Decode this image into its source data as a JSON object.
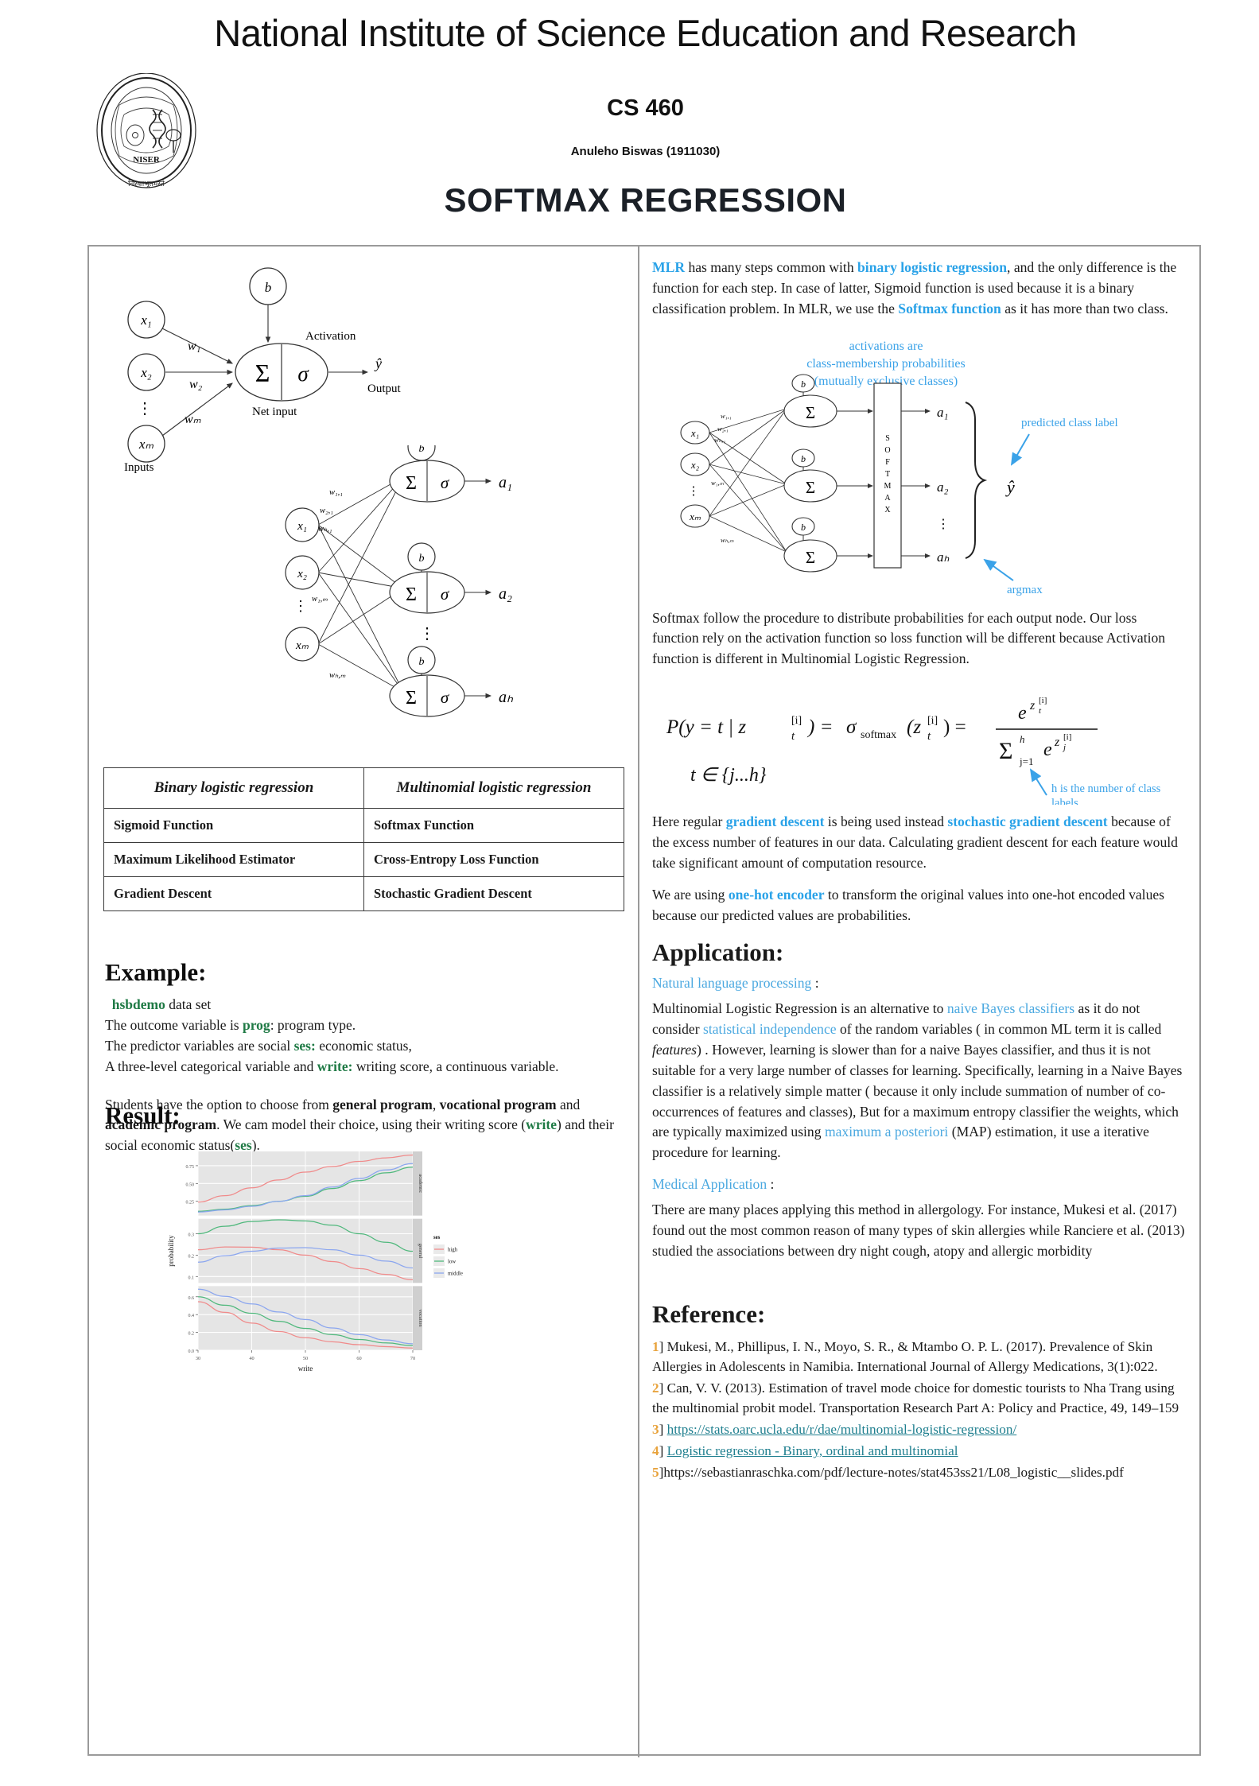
{
  "header": {
    "university": "National Institute of Science Education and Research",
    "course_code": "CS 460",
    "author": "Anuleho Biswas (1911030)",
    "poster_title": "SOFTMAX REGRESSION",
    "logo_name": "NISER",
    "logo_motto": "विश्वाःभूतमस्ते",
    "logo_top_text": "राष्ट्रीय विज्ञान शिक्षा एवं अनुसंधान संस्थान"
  },
  "left": {
    "diagram1": {
      "inputs_label": "Inputs",
      "bias": "b",
      "nodes": [
        "x₁",
        "x₂",
        "xₘ"
      ],
      "weights": [
        "w₁",
        "w₂",
        "wₘ"
      ],
      "net_input_label": "Net input",
      "activation_label": "Activation",
      "sum_symbol": "Σ",
      "sigma_symbol": "σ",
      "output_symbol": "ŷ",
      "output_label": "Output"
    },
    "diagram2": {
      "inputs": [
        "x₁",
        "x₂",
        "xₘ"
      ],
      "weights": [
        "w₁,₁",
        "w₂,₁",
        "wₕ,₁",
        "w₁,ₘ",
        "wₕ,ₘ"
      ],
      "bias": "b",
      "outputs": [
        "a₁",
        "a₂",
        "aₕ"
      ],
      "sum_symbol": "Σ",
      "sigma_symbol": "σ"
    },
    "table": {
      "headers": [
        "Binary logistic regression",
        "Multinomial logistic regression"
      ],
      "rows": [
        [
          "Sigmoid Function",
          "Softmax Function"
        ],
        [
          "Maximum Likelihood Estimator",
          "Cross-Entropy Loss Function"
        ],
        [
          "Gradient Descent",
          "Stochastic Gradient Descent"
        ]
      ]
    },
    "example": {
      "heading": "Example",
      "heading_colon": ":",
      "dataset_name": "hsbdemo",
      "dataset_suffix": " data set",
      "line_outcome_pre": "The outcome variable is  ",
      "line_outcome_var": "prog",
      "line_outcome_post": ":  program type.",
      "line_pred_pre": "The predictor variables are social ",
      "line_pred_var": "ses:",
      "line_pred_post": " economic status,",
      "line_three_pre": "A three-level categorical variable and ",
      "line_three_var": "write:",
      "line_three_post": " writing score,  a continuous variable.",
      "para2_a": "Students have the option to choose from ",
      "para2_b1": "general program",
      "para2_c": ", ",
      "para2_b2": "vocational program",
      "para2_d": " and ",
      "para2_b3": "academic program",
      "para2_e": ". We cam model their choice, using their writing score (",
      "para2_g1": "write",
      "para2_f": ") and their social economic status(",
      "para2_g2": "ses",
      "para2_h": ")."
    },
    "result": {
      "heading": "Result",
      "heading_colon": ":"
    }
  },
  "right": {
    "para1_a": "MLR",
    "para1_b": " has many steps common with ",
    "para1_c": "binary logistic regression",
    "para1_d": ", and the only difference is the function for each step. In case of latter, Sigmoid function is used because it is a binary classification problem. In MLR, we use the ",
    "para1_e": "Softmax function",
    "para1_f": " as it has more than two class.",
    "diagram3": {
      "annotation_top_line1": "activations are",
      "annotation_top_line2": "class-membership probabilities",
      "annotation_top_line3": "(mutually exclusive classes)",
      "softmax_label": "SOFTMAX",
      "predicted_label": "predicted class label",
      "argmax_label": "argmax",
      "yhat": "ŷ",
      "bias": "b",
      "sum_symbol": "Σ",
      "inputs": [
        "x₁",
        "x₂",
        "xₘ"
      ],
      "outputs": [
        "a₁",
        "a₂",
        "aₕ"
      ],
      "weights": [
        "w₁,₁",
        "w₂,₁",
        "wₕ,₁",
        "w₁,ₘ",
        "wₕ,ₘ"
      ]
    },
    "para2": "Softmax follow the procedure to distribute probabilities for each output node. Our loss function rely on the activation function so loss function will  be different because Activation function is different in Multinomial Logistic Regression.",
    "formula": {
      "main": "P(y = t | zₜ[i]) = σsoftmax(zₜ[i]) = e^{zₜ[i]} / Σ_{j=1}^{h} e^{zⱼ[i]}",
      "domain": "t ∈ {j...h}",
      "note_line1": "h is the number of class",
      "note_line2": "labels"
    },
    "para3_a": "Here regular ",
    "para3_b": "gradient descent",
    "para3_c": " is being used instead ",
    "para3_d": "stochastic gradient descent",
    "para3_e": " because of the excess number of features in our data. Calculating gradient descent for each feature would take significant amount of computation resource.",
    "para4_a": "We are using ",
    "para4_b": "one-hot encoder",
    "para4_c": " to transform the original  values into one-hot encoded  values because our predicted values are probabilities.",
    "application_heading": "Application",
    "application_colon": ":",
    "nlp_heading": "Natural language processing",
    "nlp_colon": " :",
    "nlp_a": "    Multinomial Logistic Regression is an alternative to ",
    "nlp_b": "naive Bayes classifiers",
    "nlp_c": " as it do not consider ",
    "nlp_d": "statistical independence",
    "nlp_e": " of the random variables ( in common ML term it is called ",
    "nlp_f": "features",
    "nlp_g": ") . However, learning is slower than for a naive Bayes classifier, and thus it is not suitable for a very large number of classes for learning. Specifically, learning in a Naive Bayes classifier is a relatively simple matter ( because it only include summation of number of co-occurrences of features and classes), But for a maximum entropy classifier the weights, which are typically maximized using ",
    "nlp_h": "maximum a posteriori",
    "nlp_i": " (MAP) estimation, it use a iterative procedure for learning.",
    "medical_heading": "Medical Application",
    "medical_colon": " :",
    "medical_body": " There are many places applying this method in allergology. For instance,  Mukesi et al. (2017) found out the most common reason of many types of skin allergies while Ranciere et al. (2013) studied the associations between dry night cough, atopy and allergic morbidity",
    "reference_heading": "Reference:",
    "references": [
      {
        "num": "1",
        "bracket": "]",
        "text": " Mukesi, M., Phillipus, I. N., Moyo, S. R., & Mtambo O. P. L. (2017). Prevalence of Skin Allergies in Adolescents in Namibia. International Journal of Allergy Medications, 3(1):022.",
        "link": ""
      },
      {
        "num": "2",
        "bracket": "]",
        "text": " Can, V. V. (2013). Estimation of travel mode choice for domestic tourists to Nha Trang using the multinomial probit model. Transportation Research Part A: Policy and Practice, 49, 149–159",
        "link": ""
      },
      {
        "num": "3",
        "bracket": "]",
        "text": "",
        "link": "https://stats.oarc.ucla.edu/r/dae/multinomial-logistic-regression/"
      },
      {
        "num": "4",
        "bracket": "]",
        "text": "",
        "link": "Logistic regression - Binary, ordinal and multinomial"
      },
      {
        "num": "5",
        "bracket": "]",
        "text": "https://sebastianraschka.com/pdf/lecture-notes/stat453ss21/L08_logistic__slides.pdf",
        "link": ""
      }
    ]
  },
  "colors": {
    "accent_blue": "#29a2e8",
    "accent_blue_light": "#4aa8e0",
    "accent_green": "#1f7a45",
    "link_teal": "#1f7f8f",
    "ref_number": "#e8a33d",
    "series_high": "#f08a8a",
    "series_low": "#4fb87c",
    "series_middle": "#8ba6ef"
  },
  "chart_data": {
    "type": "line",
    "title": "",
    "xlabel": "write",
    "ylabel": "probability",
    "xlim": [
      30,
      70
    ],
    "xticks": [
      30,
      40,
      50,
      60,
      70
    ],
    "grid": true,
    "legend_title": "ses",
    "legend_position": "right",
    "facets": [
      {
        "name": "academic",
        "ylim": [
          0.05,
          0.95
        ],
        "yticks": [
          0.25,
          0.5,
          0.75
        ],
        "ytick_labels": [
          "0.25",
          "0.50",
          "0.75"
        ],
        "x": [
          30,
          35,
          40,
          45,
          50,
          55,
          60,
          65,
          70
        ],
        "series": [
          {
            "name": "high",
            "color": "#f08a8a",
            "values": [
              0.24,
              0.33,
              0.44,
              0.55,
              0.66,
              0.74,
              0.81,
              0.86,
              0.9
            ]
          },
          {
            "name": "low",
            "color": "#4fb87c",
            "values": [
              0.11,
              0.14,
              0.19,
              0.25,
              0.32,
              0.43,
              0.54,
              0.65,
              0.73
            ]
          },
          {
            "name": "middle",
            "color": "#8ba6ef",
            "values": [
              0.1,
              0.13,
              0.18,
              0.25,
              0.33,
              0.45,
              0.57,
              0.69,
              0.78
            ]
          }
        ]
      },
      {
        "name": "general",
        "ylim": [
          0.07,
          0.37
        ],
        "yticks": [
          0.1,
          0.2,
          0.3
        ],
        "ytick_labels": [
          "0.1",
          "0.2",
          "0.3"
        ],
        "x": [
          30,
          35,
          40,
          45,
          50,
          55,
          60,
          65,
          70
        ],
        "series": [
          {
            "name": "high",
            "color": "#f08a8a",
            "values": [
              0.225,
              0.238,
              0.237,
              0.225,
              0.2,
              0.17,
              0.137,
              0.11,
              0.085
            ]
          },
          {
            "name": "low",
            "color": "#4fb87c",
            "values": [
              0.3,
              0.335,
              0.357,
              0.365,
              0.36,
              0.34,
              0.3,
              0.26,
              0.218
            ]
          },
          {
            "name": "middle",
            "color": "#8ba6ef",
            "values": [
              0.167,
              0.197,
              0.218,
              0.233,
              0.235,
              0.225,
              0.2,
              0.172,
              0.14
            ]
          }
        ]
      },
      {
        "name": "vocation",
        "ylim": [
          0.0,
          0.72
        ],
        "yticks": [
          0.0,
          0.2,
          0.4,
          0.6
        ],
        "ytick_labels": [
          "0.0",
          "0.2",
          "0.4",
          "0.6"
        ],
        "x": [
          30,
          35,
          40,
          45,
          50,
          55,
          60,
          65,
          70
        ],
        "series": [
          {
            "name": "high",
            "color": "#f08a8a",
            "values": [
              0.545,
              0.425,
              0.305,
              0.21,
              0.14,
              0.095,
              0.062,
              0.04,
              0.025
            ]
          },
          {
            "name": "low",
            "color": "#4fb87c",
            "values": [
              0.6,
              0.505,
              0.415,
              0.325,
              0.245,
              0.175,
              0.12,
              0.082,
              0.052
            ]
          },
          {
            "name": "middle",
            "color": "#8ba6ef",
            "values": [
              0.685,
              0.605,
              0.52,
              0.43,
              0.345,
              0.25,
              0.175,
              0.115,
              0.072
            ]
          }
        ]
      }
    ],
    "legend_entries": [
      {
        "label": "high",
        "color": "#f08a8a"
      },
      {
        "label": "low",
        "color": "#4fb87c"
      },
      {
        "label": "middle",
        "color": "#8ba6ef"
      }
    ]
  }
}
